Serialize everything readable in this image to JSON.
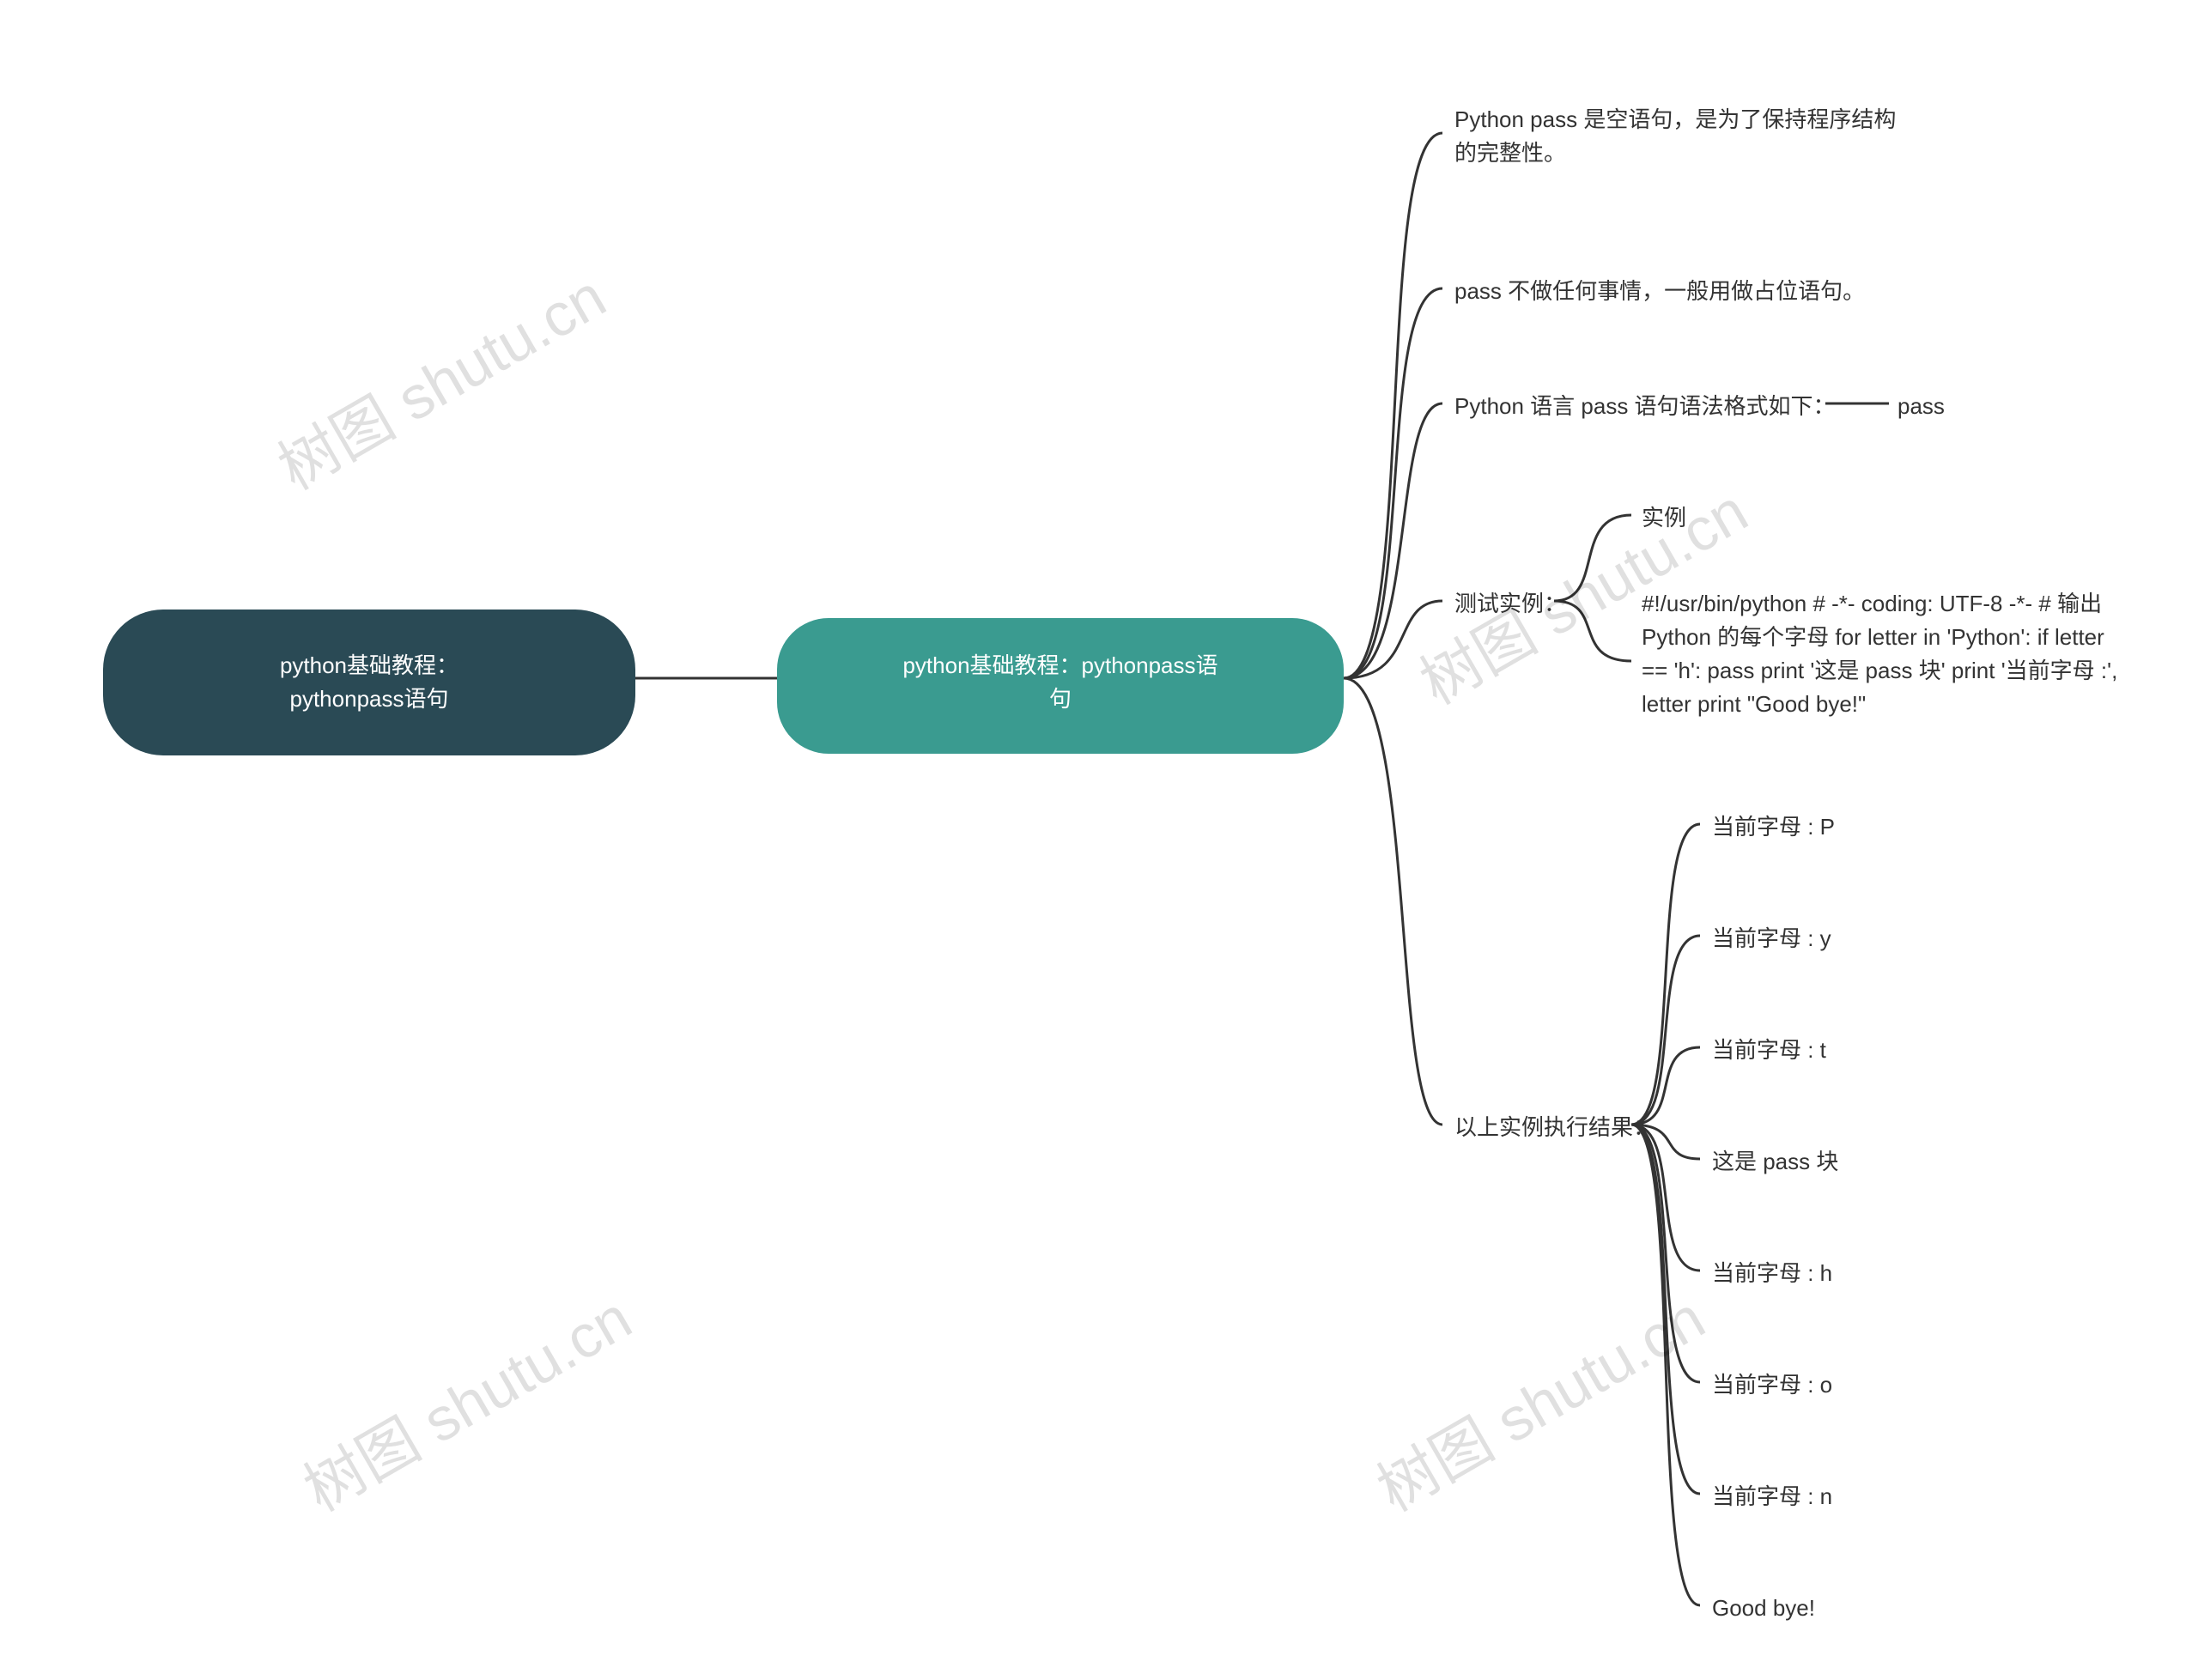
{
  "watermark": "树图 shutu.cn",
  "root": {
    "line1": "python基础教程：",
    "line2": "pythonpass语句"
  },
  "sub": {
    "line1": "python基础教程：pythonpass语",
    "line2": "句"
  },
  "branch": {
    "b1": "Python pass 是空语句，是为了保持程序结构的完整性。",
    "b2": "pass 不做任何事情，一般用做占位语句。",
    "b3": "Python 语言 pass 语句语法格式如下：",
    "b3a": "pass",
    "b4": "测试实例：",
    "b4a": "实例",
    "b4b": "#!/usr/bin/python # -*- coding: UTF-8 -*-   # 输出 Python 的每个字母 for letter in 'Python': if letter == 'h': pass print '这是 pass 块' print '当前字母 :', letter print \"Good bye!\"",
    "b5": "以上实例执行结果：",
    "b5a": "当前字母 : P",
    "b5b": "当前字母 : y",
    "b5c": "当前字母 : t",
    "b5d": "这是 pass 块",
    "b5e": "当前字母 : h",
    "b5f": "当前字母 : o",
    "b5g": "当前字母 : n",
    "b5h": "Good bye!"
  }
}
